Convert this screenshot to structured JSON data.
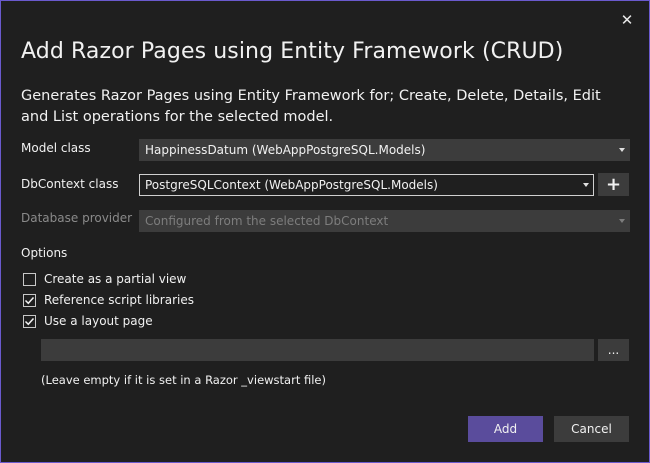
{
  "dialog": {
    "title": "Add Razor Pages using Entity Framework (CRUD)",
    "description": "Generates Razor Pages using Entity Framework for; Create, Delete, Details, Edit and List operations for the selected model.",
    "close_icon": "close-icon"
  },
  "fields": {
    "model_class": {
      "label": "Model class",
      "value": "HappinessDatum (WebAppPostgreSQL.Models)"
    },
    "dbcontext_class": {
      "label": "DbContext class",
      "value": "PostgreSQLContext (WebAppPostgreSQL.Models)",
      "add_button": "+"
    },
    "database_provider": {
      "label": "Database provider",
      "value": "Configured from the selected DbContext",
      "disabled": true
    }
  },
  "options": {
    "label": "Options",
    "items": [
      {
        "label": "Create as a partial view",
        "checked": false
      },
      {
        "label": "Reference script libraries",
        "checked": true
      },
      {
        "label": "Use a layout page",
        "checked": true
      }
    ],
    "layout_page_value": "",
    "browse_label": "...",
    "hint": "(Leave empty if it is set in a Razor _viewstart file)"
  },
  "buttons": {
    "add": "Add",
    "cancel": "Cancel"
  },
  "colors": {
    "background": "#1f1f1f",
    "accent": "#5a4c9c",
    "border": "#6a5acd",
    "control": "#3c3c3c"
  }
}
